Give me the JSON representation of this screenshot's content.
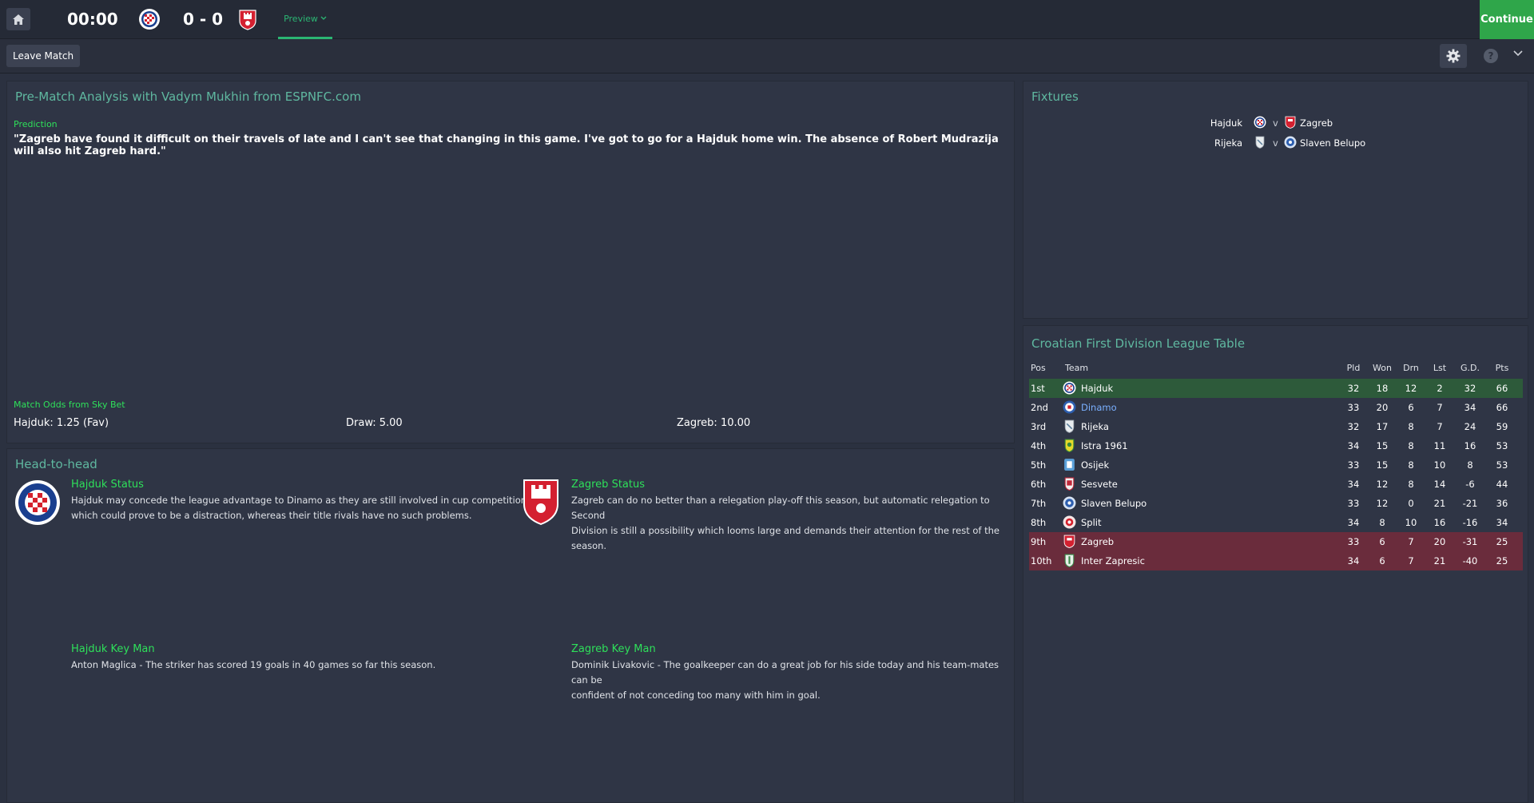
{
  "topbar": {
    "clock": "00:00",
    "score": "0 - 0",
    "tab_preview": "Preview",
    "continue_label": "Continue"
  },
  "subbar": {
    "leave_label": "Leave Match",
    "help_glyph": "?"
  },
  "analysis": {
    "title": "Pre-Match Analysis with Vadym Mukhin from ESPNFC.com",
    "prediction_label": "Prediction",
    "quote": "\"Zagreb have found it difficult on their travels of late and I can't see that changing in this game. I've got to go for a Hajduk home win. The absence of Robert Mudrazija will also hit Zagreb hard.\"",
    "odds_label": "Match Odds from Sky Bet",
    "odds_home": "Hajduk: 1.25 (Fav)",
    "odds_draw": "Draw: 5.00",
    "odds_away": "Zagreb: 10.00"
  },
  "h2h": {
    "title": "Head-to-head",
    "home_status_title": "Hajduk Status",
    "home_status_line1": "Hajduk may concede the league advantage to Dinamo as they are still involved in cup competitions",
    "home_status_line2": "which could prove to be a distraction, whereas their title rivals have no such problems.",
    "away_status_title": "Zagreb Status",
    "away_status_line1": "Zagreb can do no better than a relegation play-off this season, but automatic relegation to Second",
    "away_status_line2": "Division is still a possibility which looms large and demands their attention for the rest of the season.",
    "home_keyman_title": "Hajduk Key Man",
    "home_keyman_text": "Anton Maglica - The striker has scored 19 goals in 40 games so far this season.",
    "away_keyman_title": "Zagreb Key Man",
    "away_keyman_line1": "Dominik Livakovic - The goalkeeper can do a great job for his side today and his team-mates can be",
    "away_keyman_line2": "confident of not conceding too many with him in goal."
  },
  "fixtures": {
    "title": "Fixtures",
    "rows": [
      {
        "home": "Hajduk",
        "v": "v",
        "away": "Zagreb"
      },
      {
        "home": "Rijeka",
        "v": "v",
        "away": "Slaven Belupo"
      }
    ]
  },
  "league": {
    "title": "Croatian First Division League Table",
    "headers": {
      "pos": "Pos",
      "team": "Team",
      "pld": "Pld",
      "won": "Won",
      "drn": "Drn",
      "lst": "Lst",
      "gd": "G.D.",
      "pts": "Pts"
    },
    "rows": [
      {
        "pos": "1st",
        "team": "Hajduk",
        "pld": "32",
        "won": "18",
        "drn": "12",
        "lst": "2",
        "gd": "32",
        "pts": "66"
      },
      {
        "pos": "2nd",
        "team": "Dinamo",
        "pld": "33",
        "won": "20",
        "drn": "6",
        "lst": "7",
        "gd": "34",
        "pts": "66"
      },
      {
        "pos": "3rd",
        "team": "Rijeka",
        "pld": "32",
        "won": "17",
        "drn": "8",
        "lst": "7",
        "gd": "24",
        "pts": "59"
      },
      {
        "pos": "4th",
        "team": "Istra 1961",
        "pld": "34",
        "won": "15",
        "drn": "8",
        "lst": "11",
        "gd": "16",
        "pts": "53"
      },
      {
        "pos": "5th",
        "team": "Osijek",
        "pld": "33",
        "won": "15",
        "drn": "8",
        "lst": "10",
        "gd": "8",
        "pts": "53"
      },
      {
        "pos": "6th",
        "team": "Sesvete",
        "pld": "34",
        "won": "12",
        "drn": "8",
        "lst": "14",
        "gd": "-6",
        "pts": "44"
      },
      {
        "pos": "7th",
        "team": "Slaven Belupo",
        "pld": "33",
        "won": "12",
        "drn": "0",
        "lst": "21",
        "gd": "-21",
        "pts": "36"
      },
      {
        "pos": "8th",
        "team": "Split",
        "pld": "34",
        "won": "8",
        "drn": "10",
        "lst": "16",
        "gd": "-16",
        "pts": "34"
      },
      {
        "pos": "9th",
        "team": "Zagreb",
        "pld": "33",
        "won": "6",
        "drn": "7",
        "lst": "20",
        "gd": "-31",
        "pts": "25"
      },
      {
        "pos": "10th",
        "team": "Inter Zapresic",
        "pld": "34",
        "won": "6",
        "drn": "7",
        "lst": "21",
        "gd": "-40",
        "pts": "25"
      }
    ]
  },
  "colors": {
    "accent_green": "#2ee05a",
    "title_teal": "#5fb8a0",
    "continue_green": "#2fa64a",
    "champion_row": "#2d5a3a",
    "relegation_row": "#6a2c3c"
  }
}
